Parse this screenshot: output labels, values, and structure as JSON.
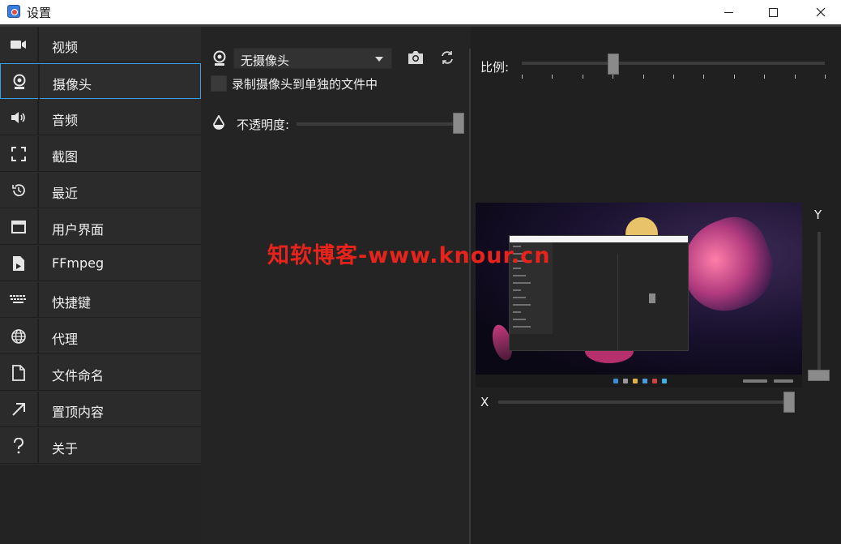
{
  "window": {
    "title": "设置",
    "minimize_icon": "minimize-icon",
    "maximize_icon": "maximize-icon",
    "close_icon": "close-icon"
  },
  "sidebar": {
    "active_index": 1,
    "items": [
      {
        "label": "视频",
        "icon": "video-camera-icon"
      },
      {
        "label": "摄像头",
        "icon": "webcam-icon"
      },
      {
        "label": "音频",
        "icon": "speaker-icon"
      },
      {
        "label": "截图",
        "icon": "screenshot-frame-icon"
      },
      {
        "label": "最近",
        "icon": "history-icon"
      },
      {
        "label": "用户界面",
        "icon": "window-icon"
      },
      {
        "label": "FFmpeg",
        "icon": "document-film-icon"
      },
      {
        "label": "快捷键",
        "icon": "keyboard-icon"
      },
      {
        "label": "代理",
        "icon": "globe-icon"
      },
      {
        "label": "文件命名",
        "icon": "file-icon"
      },
      {
        "label": "置顶内容",
        "icon": "arrow-up-right-icon"
      },
      {
        "label": "关于",
        "icon": "question-mark-icon"
      }
    ]
  },
  "camera": {
    "selected_camera": "无摄像头",
    "record_separate_label": "录制摄像头到单独的文件中",
    "record_separate_checked": false,
    "opacity_label": "不透明度:",
    "opacity_value": 1.0
  },
  "preview": {
    "ratio_label": "比例:",
    "ratio_value": 0.3,
    "x_label": "X",
    "x_value": 1.0,
    "y_label": "Y",
    "y_value": 0.0
  },
  "watermark": "知软博客-www.knour.cn",
  "colors": {
    "accent": "#3aa0e8",
    "watermark": "#e8231c"
  }
}
